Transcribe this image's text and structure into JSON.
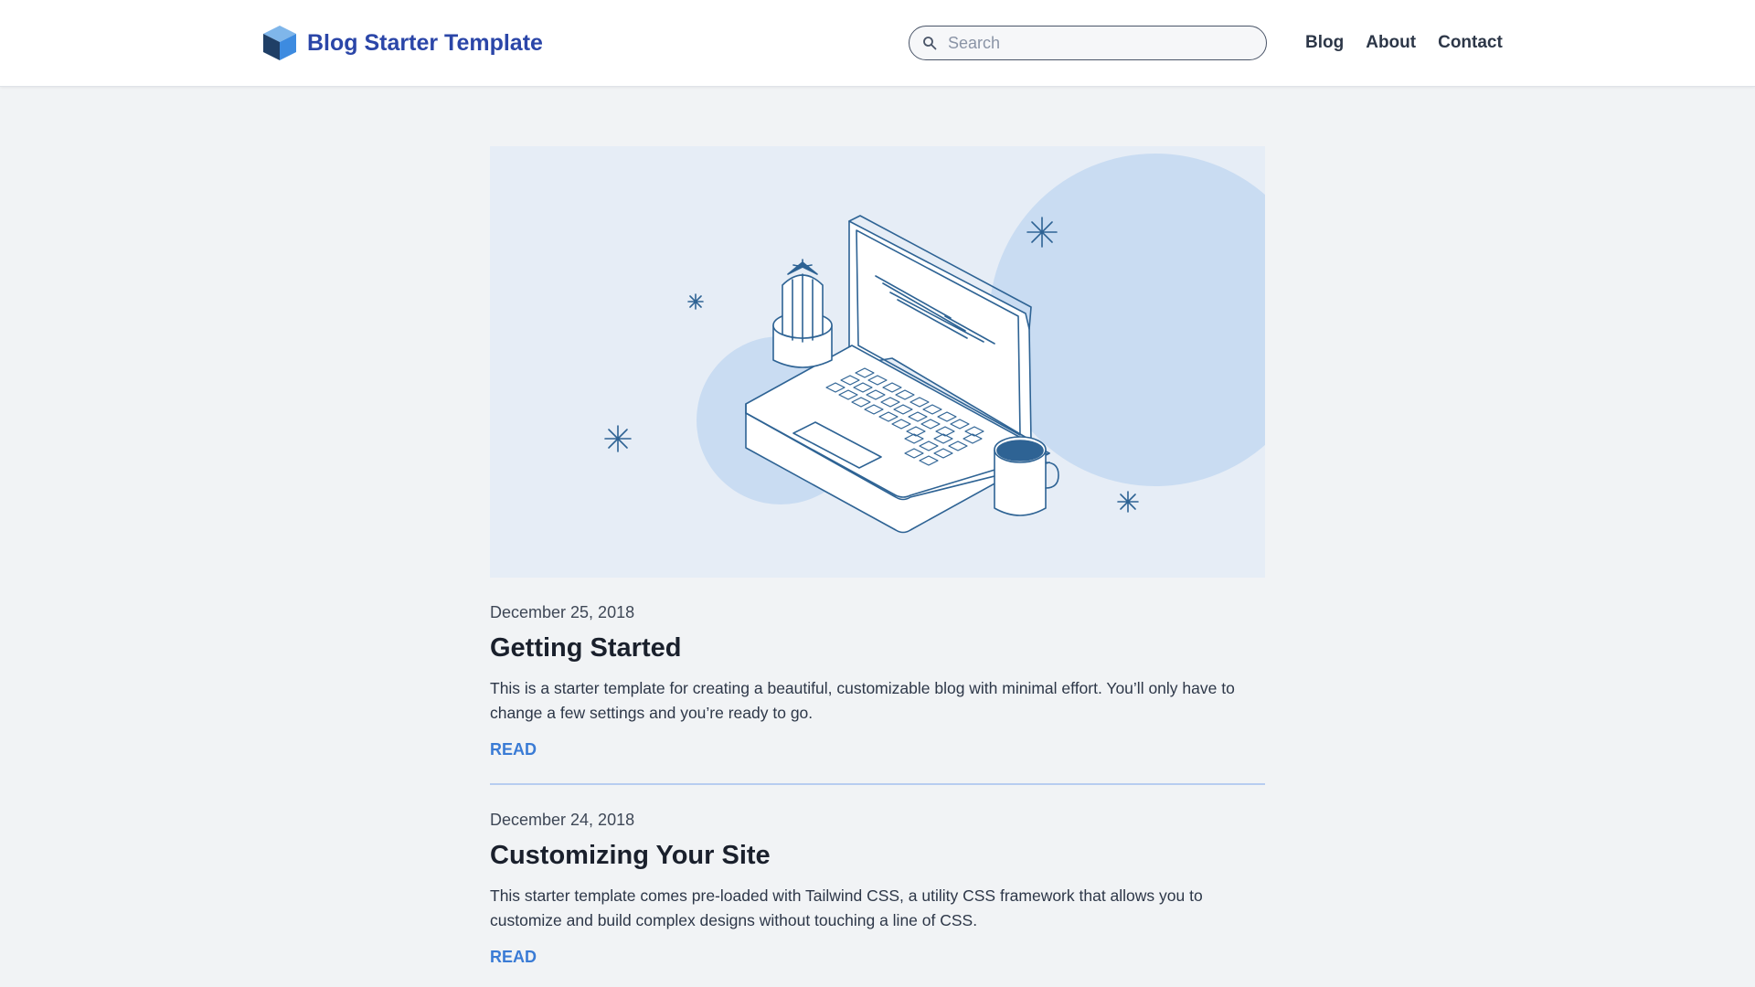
{
  "header": {
    "brand_title": "Blog Starter Template",
    "search_placeholder": "Search",
    "search_value": "",
    "nav": [
      {
        "label": "Blog"
      },
      {
        "label": "About"
      },
      {
        "label": "Contact"
      }
    ]
  },
  "hero": {
    "icon": "laptop-illustration",
    "colors": {
      "background": "#e6edf6",
      "circle": "#c9dcf2",
      "stroke": "#2e6394"
    }
  },
  "posts": [
    {
      "date": "December 25, 2018",
      "title": "Getting Started",
      "excerpt": "This is a starter template for creating a beautiful, customizable blog with minimal effort. You’ll only have to change a few settings and you’re ready to go.",
      "read_label": "READ"
    },
    {
      "date": "December 24, 2018",
      "title": "Customizing Your Site",
      "excerpt": "This starter template comes pre-loaded with Tailwind CSS, a utility CSS framework that allows you to customize and build complex designs without touching a line of CSS.",
      "read_label": "READ"
    }
  ],
  "colors": {
    "brand": "#2b46a8",
    "link": "#3a7bd5",
    "page_background": "#f1f3f5"
  }
}
